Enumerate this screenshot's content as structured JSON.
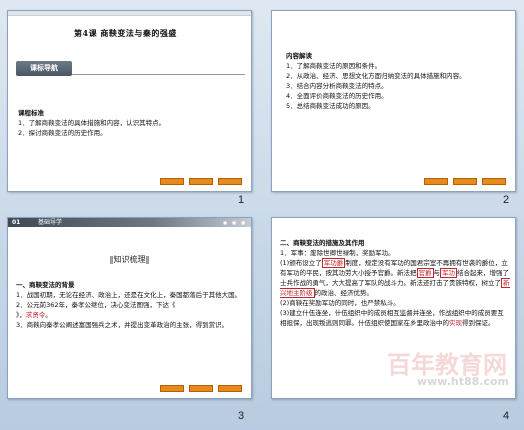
{
  "slides": [
    {
      "number": "1",
      "title_a": "第4课  ",
      "title_b": "商鞅变法与秦的强盛",
      "tab": "课标导航",
      "heading": "课程标准",
      "items": [
        "1．了解商鞅变法的具体措施和内容，认识其特点。",
        "2．探讨商鞅变法的历史作用。"
      ]
    },
    {
      "number": "2",
      "heading": "内容解读",
      "items": [
        "1．了解商鞅变法的原因和条件。",
        "2．从政治、经济、思想文化方面归纳变法的具体措施和内容。",
        "3．结合内容分析商鞅变法的特点。",
        "4．全面评价商鞅变法的历史作用。",
        "5．总结商鞅变法成功的原因。"
      ]
    },
    {
      "number": "3",
      "bar_num": "01",
      "bar_label": "基础导学",
      "knowledge": "‖知识梳理‖",
      "heading": "一、商鞅变法的背景",
      "items": [
        "1．战国初期，无论在经济、政治上，还是在文化上，秦国都落后于其他大国。",
        "2．公元前362年，秦孝公继位，决心变法图强，下达《",
        "》，",
        "求贤令",
        "。",
        "3．商鞅向秦孝公阐述富国强兵之术，并提出变革政治的主张，得到赏识。"
      ]
    },
    {
      "number": "4",
      "heading": "二、商鞅变法的措施及其作用",
      "items": [
        "1．军事：废除世卿世禄制，奖励军功。",
        "(1)颁布设立了",
        "军功爵",
        "制度，规定没有军功的国君宗室不再拥有世袭的爵位，立有军功的平民，按其功劳大小授予官爵。新法把",
        "官爵",
        "与",
        "军功",
        "结合起来，增强了士兵作战的勇气，大大提高了军队的战斗力。新法还打击了贵族特权，树立了",
        "新兴地主阶级",
        "的政治、经济优势。",
        "(2)商鞅在奖励军功的同时，也严禁私斗。",
        "(3)建立什伍连坐，什伍组织中的成员相互监督并连坐，作战组织中的成员要互相担保，出现叛逃则同罪。什伍组织使国家在乡里政治中的",
        "实现",
        "得到保证。"
      ]
    }
  ],
  "watermark": "百年教育网",
  "watermark_url": "www.ht88.com"
}
